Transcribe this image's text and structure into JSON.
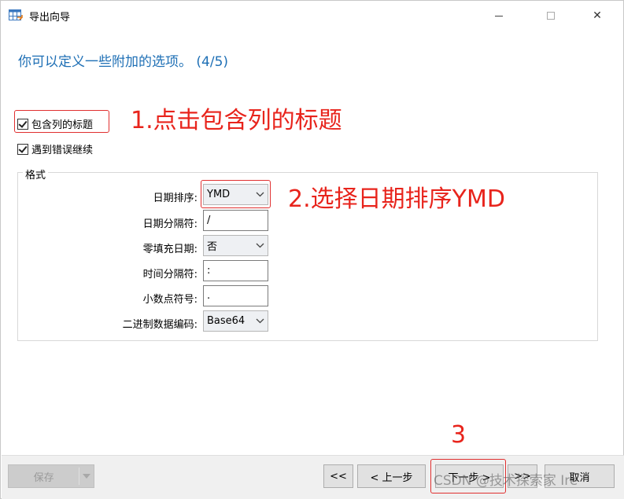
{
  "window": {
    "title": "导出向导",
    "controls": {
      "minimize": "—",
      "maximize": "",
      "close": "✕"
    }
  },
  "heading": "你可以定义一些附加的选项。 (4/5)",
  "options": {
    "include_header": {
      "label": "包含列的标题",
      "checked": true
    },
    "continue_on_error": {
      "label": "遇到错误继续",
      "checked": true
    }
  },
  "format": {
    "legend": "格式",
    "date_order": {
      "label": "日期排序:",
      "value": "YMD"
    },
    "date_separator": {
      "label": "日期分隔符:",
      "value": "/"
    },
    "zero_pad_date": {
      "label": "零填充日期:",
      "value": "否"
    },
    "time_separator": {
      "label": "时间分隔符:",
      "value": ":"
    },
    "decimal_symbol": {
      "label": "小数点符号:",
      "value": "."
    },
    "binary_encoding": {
      "label": "二进制数据编码:",
      "value": "Base64"
    }
  },
  "annotations": {
    "step1": "1.点击包含列的标题",
    "step2": "2.选择日期排序YMD",
    "step3": "3",
    "color": "#e8241c"
  },
  "buttons": {
    "save": "保存",
    "first": "<<",
    "prev": "< 上一步",
    "next": "下一步 >",
    "last": ">>",
    "cancel": "取消"
  },
  "watermark": "CSDN @技术探索家 Ire",
  "colors": {
    "heading": "#1e6fb5",
    "annotation": "#e8241c"
  }
}
